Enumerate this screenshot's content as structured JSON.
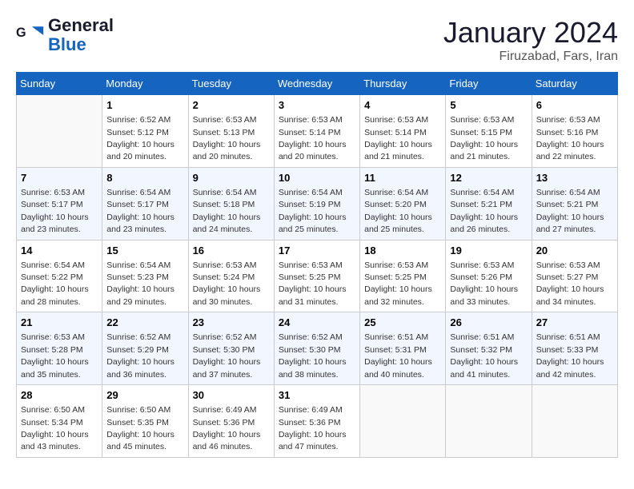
{
  "header": {
    "logo_line1": "General",
    "logo_line2": "Blue",
    "title": "January 2024",
    "subtitle": "Firuzabad, Fars, Iran"
  },
  "weekdays": [
    "Sunday",
    "Monday",
    "Tuesday",
    "Wednesday",
    "Thursday",
    "Friday",
    "Saturday"
  ],
  "weeks": [
    [
      {
        "day": "",
        "sunrise": "",
        "sunset": "",
        "daylight": ""
      },
      {
        "day": "1",
        "sunrise": "Sunrise: 6:52 AM",
        "sunset": "Sunset: 5:12 PM",
        "daylight": "Daylight: 10 hours and 20 minutes."
      },
      {
        "day": "2",
        "sunrise": "Sunrise: 6:53 AM",
        "sunset": "Sunset: 5:13 PM",
        "daylight": "Daylight: 10 hours and 20 minutes."
      },
      {
        "day": "3",
        "sunrise": "Sunrise: 6:53 AM",
        "sunset": "Sunset: 5:14 PM",
        "daylight": "Daylight: 10 hours and 20 minutes."
      },
      {
        "day": "4",
        "sunrise": "Sunrise: 6:53 AM",
        "sunset": "Sunset: 5:14 PM",
        "daylight": "Daylight: 10 hours and 21 minutes."
      },
      {
        "day": "5",
        "sunrise": "Sunrise: 6:53 AM",
        "sunset": "Sunset: 5:15 PM",
        "daylight": "Daylight: 10 hours and 21 minutes."
      },
      {
        "day": "6",
        "sunrise": "Sunrise: 6:53 AM",
        "sunset": "Sunset: 5:16 PM",
        "daylight": "Daylight: 10 hours and 22 minutes."
      }
    ],
    [
      {
        "day": "7",
        "sunrise": "Sunrise: 6:53 AM",
        "sunset": "Sunset: 5:17 PM",
        "daylight": "Daylight: 10 hours and 23 minutes."
      },
      {
        "day": "8",
        "sunrise": "Sunrise: 6:54 AM",
        "sunset": "Sunset: 5:17 PM",
        "daylight": "Daylight: 10 hours and 23 minutes."
      },
      {
        "day": "9",
        "sunrise": "Sunrise: 6:54 AM",
        "sunset": "Sunset: 5:18 PM",
        "daylight": "Daylight: 10 hours and 24 minutes."
      },
      {
        "day": "10",
        "sunrise": "Sunrise: 6:54 AM",
        "sunset": "Sunset: 5:19 PM",
        "daylight": "Daylight: 10 hours and 25 minutes."
      },
      {
        "day": "11",
        "sunrise": "Sunrise: 6:54 AM",
        "sunset": "Sunset: 5:20 PM",
        "daylight": "Daylight: 10 hours and 25 minutes."
      },
      {
        "day": "12",
        "sunrise": "Sunrise: 6:54 AM",
        "sunset": "Sunset: 5:21 PM",
        "daylight": "Daylight: 10 hours and 26 minutes."
      },
      {
        "day": "13",
        "sunrise": "Sunrise: 6:54 AM",
        "sunset": "Sunset: 5:21 PM",
        "daylight": "Daylight: 10 hours and 27 minutes."
      }
    ],
    [
      {
        "day": "14",
        "sunrise": "Sunrise: 6:54 AM",
        "sunset": "Sunset: 5:22 PM",
        "daylight": "Daylight: 10 hours and 28 minutes."
      },
      {
        "day": "15",
        "sunrise": "Sunrise: 6:54 AM",
        "sunset": "Sunset: 5:23 PM",
        "daylight": "Daylight: 10 hours and 29 minutes."
      },
      {
        "day": "16",
        "sunrise": "Sunrise: 6:53 AM",
        "sunset": "Sunset: 5:24 PM",
        "daylight": "Daylight: 10 hours and 30 minutes."
      },
      {
        "day": "17",
        "sunrise": "Sunrise: 6:53 AM",
        "sunset": "Sunset: 5:25 PM",
        "daylight": "Daylight: 10 hours and 31 minutes."
      },
      {
        "day": "18",
        "sunrise": "Sunrise: 6:53 AM",
        "sunset": "Sunset: 5:25 PM",
        "daylight": "Daylight: 10 hours and 32 minutes."
      },
      {
        "day": "19",
        "sunrise": "Sunrise: 6:53 AM",
        "sunset": "Sunset: 5:26 PM",
        "daylight": "Daylight: 10 hours and 33 minutes."
      },
      {
        "day": "20",
        "sunrise": "Sunrise: 6:53 AM",
        "sunset": "Sunset: 5:27 PM",
        "daylight": "Daylight: 10 hours and 34 minutes."
      }
    ],
    [
      {
        "day": "21",
        "sunrise": "Sunrise: 6:53 AM",
        "sunset": "Sunset: 5:28 PM",
        "daylight": "Daylight: 10 hours and 35 minutes."
      },
      {
        "day": "22",
        "sunrise": "Sunrise: 6:52 AM",
        "sunset": "Sunset: 5:29 PM",
        "daylight": "Daylight: 10 hours and 36 minutes."
      },
      {
        "day": "23",
        "sunrise": "Sunrise: 6:52 AM",
        "sunset": "Sunset: 5:30 PM",
        "daylight": "Daylight: 10 hours and 37 minutes."
      },
      {
        "day": "24",
        "sunrise": "Sunrise: 6:52 AM",
        "sunset": "Sunset: 5:30 PM",
        "daylight": "Daylight: 10 hours and 38 minutes."
      },
      {
        "day": "25",
        "sunrise": "Sunrise: 6:51 AM",
        "sunset": "Sunset: 5:31 PM",
        "daylight": "Daylight: 10 hours and 40 minutes."
      },
      {
        "day": "26",
        "sunrise": "Sunrise: 6:51 AM",
        "sunset": "Sunset: 5:32 PM",
        "daylight": "Daylight: 10 hours and 41 minutes."
      },
      {
        "day": "27",
        "sunrise": "Sunrise: 6:51 AM",
        "sunset": "Sunset: 5:33 PM",
        "daylight": "Daylight: 10 hours and 42 minutes."
      }
    ],
    [
      {
        "day": "28",
        "sunrise": "Sunrise: 6:50 AM",
        "sunset": "Sunset: 5:34 PM",
        "daylight": "Daylight: 10 hours and 43 minutes."
      },
      {
        "day": "29",
        "sunrise": "Sunrise: 6:50 AM",
        "sunset": "Sunset: 5:35 PM",
        "daylight": "Daylight: 10 hours and 45 minutes."
      },
      {
        "day": "30",
        "sunrise": "Sunrise: 6:49 AM",
        "sunset": "Sunset: 5:36 PM",
        "daylight": "Daylight: 10 hours and 46 minutes."
      },
      {
        "day": "31",
        "sunrise": "Sunrise: 6:49 AM",
        "sunset": "Sunset: 5:36 PM",
        "daylight": "Daylight: 10 hours and 47 minutes."
      },
      {
        "day": "",
        "sunrise": "",
        "sunset": "",
        "daylight": ""
      },
      {
        "day": "",
        "sunrise": "",
        "sunset": "",
        "daylight": ""
      },
      {
        "day": "",
        "sunrise": "",
        "sunset": "",
        "daylight": ""
      }
    ]
  ]
}
